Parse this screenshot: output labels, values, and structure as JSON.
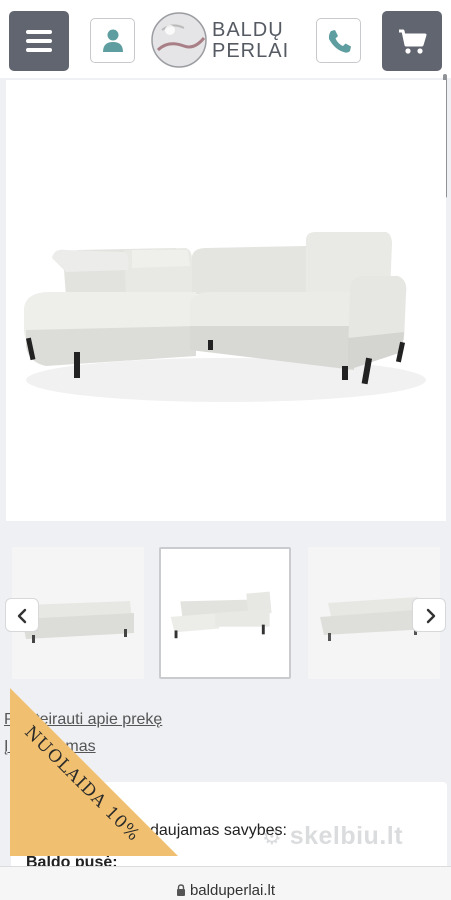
{
  "header": {
    "logo_line1": "BALDŲ",
    "logo_line2": "PERLAI"
  },
  "links": {
    "inquire": "Pasiteirauti apie prekę",
    "favorite": "Į Mėgstamas"
  },
  "promo": {
    "text": "NUOLAIDA 10%",
    "color": "#f0c070"
  },
  "details": {
    "intro_text": "daujamas savybes:",
    "side_label": "Baldo pusė:"
  },
  "watermark": "skelbiu.lt",
  "browser": {
    "url": "balduperlai.lt"
  },
  "colors": {
    "dark_button": "#616570",
    "teal_icon": "#5f9ea0",
    "promo": "#f0c070"
  }
}
